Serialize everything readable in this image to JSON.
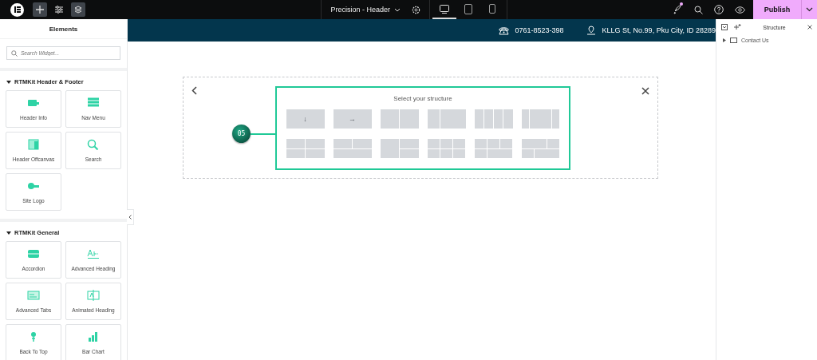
{
  "topbar": {
    "document_title": "Precision - Header",
    "devices": [
      {
        "kind": "desktop",
        "selected": true
      },
      {
        "kind": "tablet",
        "selected": false
      },
      {
        "kind": "mobile",
        "selected": false
      }
    ],
    "tools": [
      {
        "kind": "add",
        "selected": true
      },
      {
        "kind": "settings",
        "selected": false
      },
      {
        "kind": "layers",
        "selected": true
      }
    ],
    "notification": true,
    "publish": "Publish"
  },
  "elements_panel": {
    "title": "Elements",
    "search": {
      "placeholder": "Search Widget..."
    },
    "categories": [
      {
        "name": "RTMKit Header & Footer",
        "expanded": true,
        "widgets": [
          {
            "label": "Header Info",
            "kind": "info"
          },
          {
            "label": "Nav Menu",
            "kind": "menu"
          },
          {
            "label": "Header Offcanvas",
            "kind": "offcanvas"
          },
          {
            "label": "Search",
            "kind": "search"
          },
          {
            "label": "Site Logo",
            "kind": "logo"
          }
        ]
      },
      {
        "name": "RTMKit General",
        "expanded": true,
        "widgets": [
          {
            "label": "Accordion",
            "kind": "accordion"
          },
          {
            "label": "Advanced Heading",
            "kind": "heading"
          },
          {
            "label": "Advanced Tabs",
            "kind": "tabs"
          },
          {
            "label": "Animated Heading",
            "kind": "animated"
          },
          {
            "label": "Back To Top",
            "kind": "top"
          },
          {
            "label": "Bar Chart",
            "kind": "chart"
          }
        ]
      }
    ]
  },
  "header_bar": {
    "phone": "0761-8523-398",
    "address": "KLLG St, No.99, Pku City, ID 28289"
  },
  "structure_picker": {
    "title": "Select your structure",
    "step_badge": "05",
    "presets": [
      {
        "kind": "direction",
        "label": "↓"
      },
      {
        "kind": "direction",
        "label": "→"
      },
      {
        "kind": "halves"
      },
      {
        "kind": "thirdleft"
      },
      {
        "kind": "quarters"
      },
      {
        "kind": "widecenter"
      },
      {
        "kind": "grid4"
      },
      {
        "kind": "twoone"
      },
      {
        "kind": "onetwo"
      },
      {
        "kind": "grid6"
      },
      {
        "kind": "threetwo"
      },
      {
        "kind": "offset"
      }
    ]
  },
  "structure_panel": {
    "title": "Structure",
    "items": [
      {
        "label": "Contact Us",
        "expanded": false
      }
    ]
  }
}
